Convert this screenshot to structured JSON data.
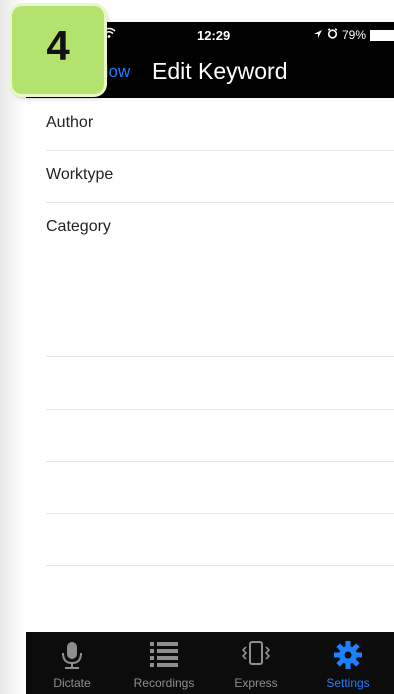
{
  "badge": {
    "number": "4"
  },
  "status_bar": {
    "time": "12:29",
    "battery": "79%"
  },
  "nav": {
    "back_label": "flow",
    "title": "Edit Keyword"
  },
  "fields": [
    {
      "label": "Author"
    },
    {
      "label": "Worktype"
    },
    {
      "label": "Category"
    }
  ],
  "tabs": [
    {
      "label": "Dictate",
      "icon": "microphone-icon",
      "active": false
    },
    {
      "label": "Recordings",
      "icon": "list-icon",
      "active": false
    },
    {
      "label": "Express",
      "icon": "phone-vibrate-icon",
      "active": false
    },
    {
      "label": "Settings",
      "icon": "gear-icon",
      "active": true
    }
  ],
  "colors": {
    "accent": "#1e7fff",
    "badge": "#b4e26e",
    "bar": "#000000"
  }
}
